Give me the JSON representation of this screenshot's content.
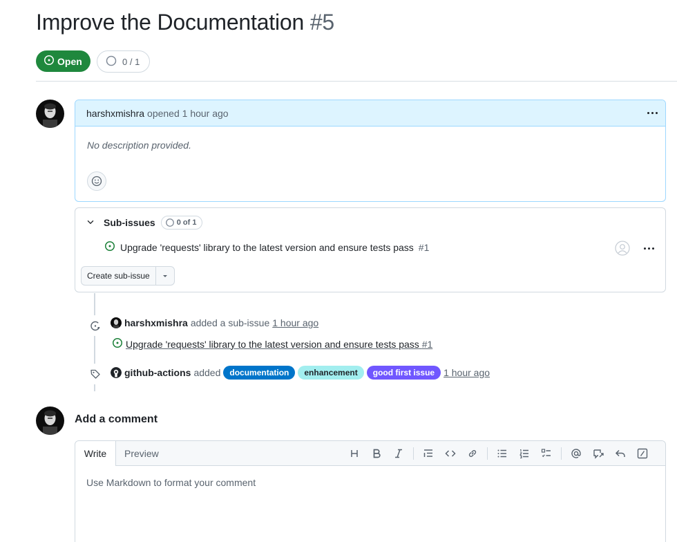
{
  "issue": {
    "title": "Improve the Documentation",
    "number": "#5",
    "state_label": "Open",
    "subissue_progress": "0 / 1"
  },
  "comment": {
    "author": "harshxmishra",
    "action": "opened",
    "time": "1 hour ago",
    "body": "No description provided."
  },
  "subissues": {
    "title": "Sub-issues",
    "count": "0 of 1",
    "items": [
      {
        "title": "Upgrade 'requests' library to the latest version and ensure tests pass",
        "ref": "#1"
      }
    ],
    "create_label": "Create sub-issue"
  },
  "timeline": {
    "subissue_event": {
      "actor": "harshxmishra",
      "action": "added a sub-issue",
      "time": "1 hour ago",
      "link_title": "Upgrade 'requests' library to the latest version and ensure tests pass",
      "link_ref": "#1"
    },
    "label_event": {
      "actor": "github-actions",
      "action": "added",
      "time": "1 hour ago",
      "labels": [
        {
          "name": "documentation",
          "bg": "#0075ca",
          "fg": "#ffffff"
        },
        {
          "name": "enhancement",
          "bg": "#a2eeef",
          "fg": "#1f2328"
        },
        {
          "name": "good first issue",
          "bg": "#7057ff",
          "fg": "#ffffff"
        }
      ]
    }
  },
  "composer": {
    "heading": "Add a comment",
    "tab_write": "Write",
    "tab_preview": "Preview",
    "placeholder": "Use Markdown to format your comment"
  },
  "colors": {
    "open_green": "#1f883d",
    "comment_header_bg": "#ddf4ff",
    "comment_border": "#9cd7ff",
    "border": "#d1d9e0",
    "muted_text": "#59636e"
  }
}
